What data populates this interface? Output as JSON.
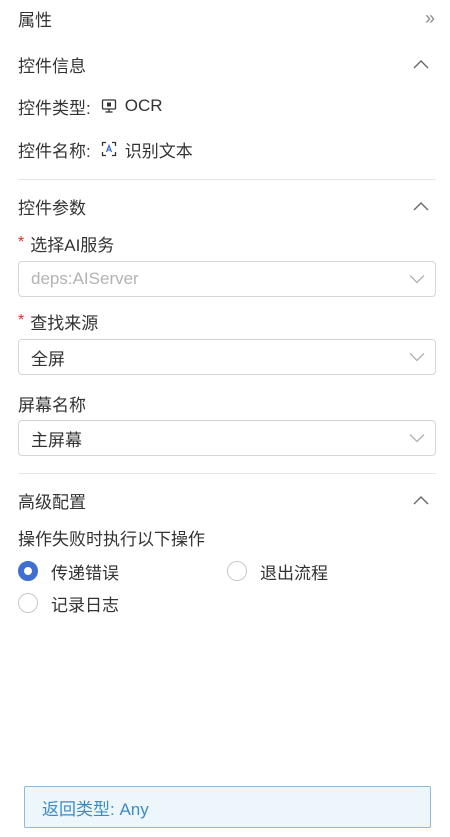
{
  "panel": {
    "title": "属性",
    "collapse_glyph": "»"
  },
  "control_info": {
    "heading": "控件信息",
    "type_label": "控件类型:",
    "type_icon": "monitor-icon",
    "type_value": "OCR",
    "name_label": "控件名称:",
    "name_icon": "scan-text-icon",
    "name_value": "识别文本"
  },
  "control_params": {
    "heading": "控件参数",
    "ai_service": {
      "label": "选择AI服务",
      "required_mark": "*",
      "value": "deps:AIServer"
    },
    "find_source": {
      "label": "查找来源",
      "required_mark": "*",
      "value": "全屏"
    },
    "screen_name": {
      "label": "屏幕名称",
      "value": "主屏幕"
    }
  },
  "advanced": {
    "heading": "高级配置",
    "on_fail_label": "操作失败时执行以下操作",
    "options": [
      {
        "label": "传递错误",
        "selected": true
      },
      {
        "label": "退出流程",
        "selected": false
      },
      {
        "label": "记录日志",
        "selected": false
      }
    ]
  },
  "footer": {
    "return_type": "返回类型: Any"
  },
  "colors": {
    "accent": "#3f6fd1",
    "required": "#e0302d",
    "footer_text": "#3d8bc4",
    "footer_bg": "#edf6fb",
    "footer_border": "#8fbad9"
  }
}
